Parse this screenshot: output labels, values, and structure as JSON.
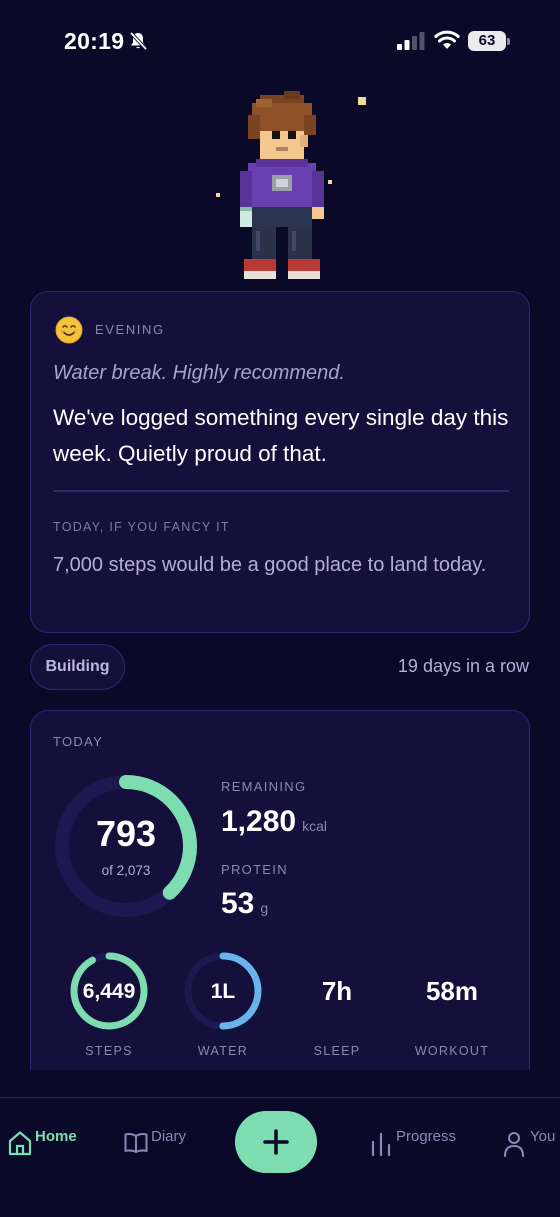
{
  "status_bar": {
    "time": "20:19",
    "battery": "63",
    "icons": [
      "bell-slash-icon",
      "signal-icon",
      "wifi-icon",
      "battery-icon"
    ]
  },
  "colors": {
    "background": "#0b0928",
    "card": "#150f3c",
    "card_border": "#2c2670",
    "accent_green": "#7ddcb0",
    "accent_blue": "#6ab4ee",
    "muted_text": "#8c86b4"
  },
  "message_card": {
    "icon": "smiling-face-icon",
    "time_label": "EVENING",
    "tip": "Water break. Highly recommend.",
    "message": "We've logged something every single day this week. Quietly proud of that.",
    "suggestion_label": "TODAY, IF YOU FANCY IT",
    "suggestion": "7,000 steps would be a good place to land today."
  },
  "streak": {
    "badge": "Building",
    "text": "19 days in a row"
  },
  "today": {
    "label": "TODAY",
    "calories": {
      "value": "793",
      "goal_text": "of 2,073",
      "progress": 0.38
    },
    "remaining": {
      "label": "REMAINING",
      "value": "1,280",
      "unit": "kcal"
    },
    "protein": {
      "label": "PROTEIN",
      "value": "53",
      "unit": "g"
    },
    "metrics": [
      {
        "label": "STEPS",
        "value": "6,449",
        "progress": 0.92,
        "color": "#7ddcb0"
      },
      {
        "label": "WATER",
        "value": "1L",
        "progress": 0.5,
        "color": "#6ab4ee"
      },
      {
        "label": "SLEEP",
        "value": "7h"
      },
      {
        "label": "WORKOUT",
        "value": "58m"
      }
    ]
  },
  "nav": {
    "items": [
      {
        "label": "Home",
        "icon": "home-icon",
        "active": true
      },
      {
        "label": "Diary",
        "icon": "book-icon",
        "active": false
      },
      {
        "label": "Progress",
        "icon": "bar-chart-icon",
        "active": false
      },
      {
        "label": "You",
        "icon": "person-icon",
        "active": false
      }
    ],
    "add_icon": "plus-icon"
  }
}
